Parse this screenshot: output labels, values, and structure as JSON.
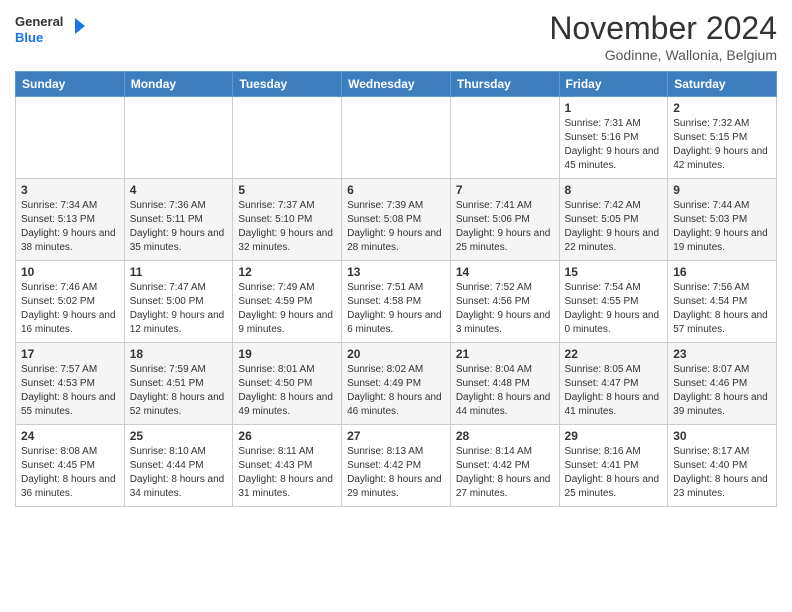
{
  "header": {
    "logo": {
      "text_general": "General",
      "text_blue": "Blue",
      "icon": "▶"
    },
    "title": "November 2024",
    "subtitle": "Godinne, Wallonia, Belgium"
  },
  "weekdays": [
    "Sunday",
    "Monday",
    "Tuesday",
    "Wednesday",
    "Thursday",
    "Friday",
    "Saturday"
  ],
  "weeks": [
    [
      {
        "day": "",
        "info": ""
      },
      {
        "day": "",
        "info": ""
      },
      {
        "day": "",
        "info": ""
      },
      {
        "day": "",
        "info": ""
      },
      {
        "day": "",
        "info": ""
      },
      {
        "day": "1",
        "info": "Sunrise: 7:31 AM\nSunset: 5:16 PM\nDaylight: 9 hours\nand 45 minutes."
      },
      {
        "day": "2",
        "info": "Sunrise: 7:32 AM\nSunset: 5:15 PM\nDaylight: 9 hours\nand 42 minutes."
      }
    ],
    [
      {
        "day": "3",
        "info": "Sunrise: 7:34 AM\nSunset: 5:13 PM\nDaylight: 9 hours\nand 38 minutes."
      },
      {
        "day": "4",
        "info": "Sunrise: 7:36 AM\nSunset: 5:11 PM\nDaylight: 9 hours\nand 35 minutes."
      },
      {
        "day": "5",
        "info": "Sunrise: 7:37 AM\nSunset: 5:10 PM\nDaylight: 9 hours\nand 32 minutes."
      },
      {
        "day": "6",
        "info": "Sunrise: 7:39 AM\nSunset: 5:08 PM\nDaylight: 9 hours\nand 28 minutes."
      },
      {
        "day": "7",
        "info": "Sunrise: 7:41 AM\nSunset: 5:06 PM\nDaylight: 9 hours\nand 25 minutes."
      },
      {
        "day": "8",
        "info": "Sunrise: 7:42 AM\nSunset: 5:05 PM\nDaylight: 9 hours\nand 22 minutes."
      },
      {
        "day": "9",
        "info": "Sunrise: 7:44 AM\nSunset: 5:03 PM\nDaylight: 9 hours\nand 19 minutes."
      }
    ],
    [
      {
        "day": "10",
        "info": "Sunrise: 7:46 AM\nSunset: 5:02 PM\nDaylight: 9 hours\nand 16 minutes."
      },
      {
        "day": "11",
        "info": "Sunrise: 7:47 AM\nSunset: 5:00 PM\nDaylight: 9 hours\nand 12 minutes."
      },
      {
        "day": "12",
        "info": "Sunrise: 7:49 AM\nSunset: 4:59 PM\nDaylight: 9 hours\nand 9 minutes."
      },
      {
        "day": "13",
        "info": "Sunrise: 7:51 AM\nSunset: 4:58 PM\nDaylight: 9 hours\nand 6 minutes."
      },
      {
        "day": "14",
        "info": "Sunrise: 7:52 AM\nSunset: 4:56 PM\nDaylight: 9 hours\nand 3 minutes."
      },
      {
        "day": "15",
        "info": "Sunrise: 7:54 AM\nSunset: 4:55 PM\nDaylight: 9 hours\nand 0 minutes."
      },
      {
        "day": "16",
        "info": "Sunrise: 7:56 AM\nSunset: 4:54 PM\nDaylight: 8 hours\nand 57 minutes."
      }
    ],
    [
      {
        "day": "17",
        "info": "Sunrise: 7:57 AM\nSunset: 4:53 PM\nDaylight: 8 hours\nand 55 minutes."
      },
      {
        "day": "18",
        "info": "Sunrise: 7:59 AM\nSunset: 4:51 PM\nDaylight: 8 hours\nand 52 minutes."
      },
      {
        "day": "19",
        "info": "Sunrise: 8:01 AM\nSunset: 4:50 PM\nDaylight: 8 hours\nand 49 minutes."
      },
      {
        "day": "20",
        "info": "Sunrise: 8:02 AM\nSunset: 4:49 PM\nDaylight: 8 hours\nand 46 minutes."
      },
      {
        "day": "21",
        "info": "Sunrise: 8:04 AM\nSunset: 4:48 PM\nDaylight: 8 hours\nand 44 minutes."
      },
      {
        "day": "22",
        "info": "Sunrise: 8:05 AM\nSunset: 4:47 PM\nDaylight: 8 hours\nand 41 minutes."
      },
      {
        "day": "23",
        "info": "Sunrise: 8:07 AM\nSunset: 4:46 PM\nDaylight: 8 hours\nand 39 minutes."
      }
    ],
    [
      {
        "day": "24",
        "info": "Sunrise: 8:08 AM\nSunset: 4:45 PM\nDaylight: 8 hours\nand 36 minutes."
      },
      {
        "day": "25",
        "info": "Sunrise: 8:10 AM\nSunset: 4:44 PM\nDaylight: 8 hours\nand 34 minutes."
      },
      {
        "day": "26",
        "info": "Sunrise: 8:11 AM\nSunset: 4:43 PM\nDaylight: 8 hours\nand 31 minutes."
      },
      {
        "day": "27",
        "info": "Sunrise: 8:13 AM\nSunset: 4:42 PM\nDaylight: 8 hours\nand 29 minutes."
      },
      {
        "day": "28",
        "info": "Sunrise: 8:14 AM\nSunset: 4:42 PM\nDaylight: 8 hours\nand 27 minutes."
      },
      {
        "day": "29",
        "info": "Sunrise: 8:16 AM\nSunset: 4:41 PM\nDaylight: 8 hours\nand 25 minutes."
      },
      {
        "day": "30",
        "info": "Sunrise: 8:17 AM\nSunset: 4:40 PM\nDaylight: 8 hours\nand 23 minutes."
      }
    ]
  ]
}
